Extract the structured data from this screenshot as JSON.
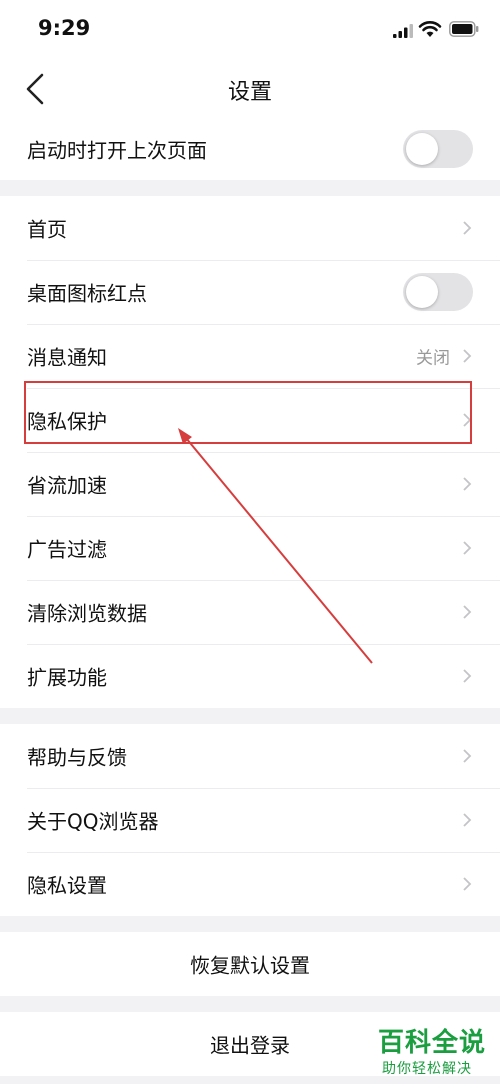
{
  "status_bar": {
    "time": "9:29"
  },
  "nav": {
    "title": "设置"
  },
  "group0": [
    {
      "label": "启动时打开上次页面",
      "toggle": false
    }
  ],
  "group1": [
    {
      "label": "首页"
    },
    {
      "label": "桌面图标红点",
      "toggle": false
    },
    {
      "label": "消息通知",
      "value": "关闭"
    },
    {
      "label": "隐私保护"
    },
    {
      "label": "省流加速"
    },
    {
      "label": "广告过滤"
    },
    {
      "label": "清除浏览数据"
    },
    {
      "label": "扩展功能"
    }
  ],
  "group2": [
    {
      "label": "帮助与反馈"
    },
    {
      "label": "关于QQ浏览器"
    },
    {
      "label": "隐私设置"
    }
  ],
  "restore": {
    "label": "恢复默认设置"
  },
  "logout": {
    "label": "退出登录"
  },
  "watermark": {
    "title": "百科全说",
    "subtitle": "助你轻松解决"
  },
  "colors": {
    "highlight": "#d63d3d",
    "watermark": "#1a9e3f",
    "toggle_off": "#e3e3e6"
  }
}
